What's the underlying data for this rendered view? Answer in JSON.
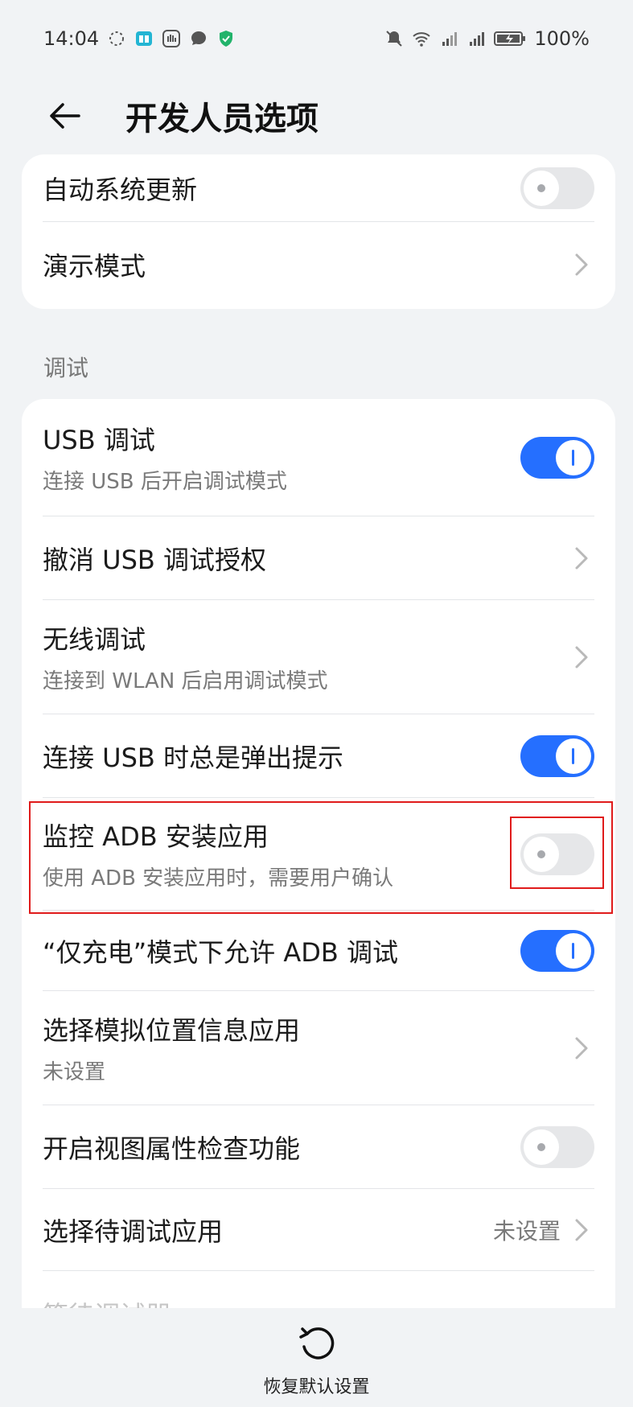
{
  "status": {
    "time": "14:04",
    "battery": "100%"
  },
  "header": {
    "title": "开发人员选项"
  },
  "group_top": {
    "rows": [
      {
        "title": "自动系统更新",
        "control": "toggle",
        "state": "off"
      },
      {
        "title": "演示模式",
        "control": "chevron"
      }
    ]
  },
  "section_debug": {
    "label": "调试"
  },
  "group_debug": {
    "rows": [
      {
        "title": "USB 调试",
        "subtitle": "连接 USB 后开启调试模式",
        "control": "toggle",
        "state": "on"
      },
      {
        "title": "撤消 USB 调试授权",
        "control": "chevron"
      },
      {
        "title": "无线调试",
        "subtitle": "连接到 WLAN 后启用调试模式",
        "control": "chevron"
      },
      {
        "title": "连接 USB 时总是弹出提示",
        "control": "toggle",
        "state": "on"
      },
      {
        "title": "监控 ADB 安装应用",
        "subtitle": "使用 ADB 安装应用时，需要用户确认",
        "control": "toggle",
        "state": "off"
      },
      {
        "title": "“仅充电”模式下允许 ADB 调试",
        "control": "toggle",
        "state": "on"
      },
      {
        "title": "选择模拟位置信息应用",
        "subtitle": "未设置",
        "control": "chevron"
      },
      {
        "title": "开启视图属性检查功能",
        "control": "toggle",
        "state": "off"
      },
      {
        "title": "选择待调试应用",
        "value": "未设置",
        "control": "chevron"
      },
      {
        "title": "等待调试器"
      }
    ]
  },
  "bottom": {
    "reset_label": "恢复默认设置"
  },
  "colors": {
    "accent": "#256fff",
    "highlight": "#e01b1b",
    "background": "#f1f3f5"
  }
}
